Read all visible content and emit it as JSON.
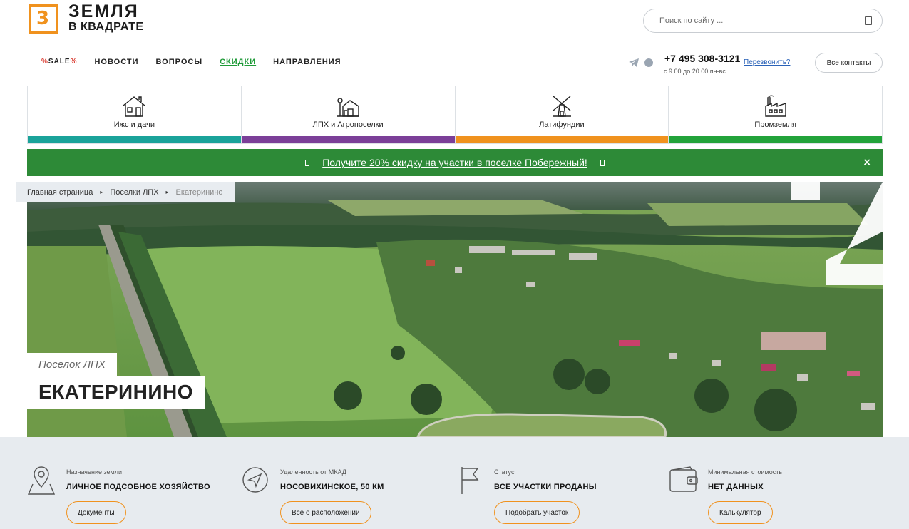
{
  "logo": {
    "line1": "ЗЕМЛЯ",
    "line2": "В КВАДРАТЕ",
    "accent": "#f0921e"
  },
  "search": {
    "placeholder": "Поиск по сайту ..."
  },
  "nav": {
    "sale_prefix": "%",
    "sale_text": "SALE",
    "sale_suffix": "%",
    "items": [
      {
        "label": "НОВОСТИ"
      },
      {
        "label": "ВОПРОСЫ"
      },
      {
        "label": "СКИДКИ"
      },
      {
        "label": "НАПРАВЛЕНИЯ"
      }
    ]
  },
  "contact": {
    "phone": "+7 495 308-3121",
    "hours": "с 9.00 до 20.00 пн-вс",
    "callback": "Перезвонить?",
    "all_contacts": "Все контакты"
  },
  "categories": [
    {
      "label": "Ижс и дачи",
      "color": "#1aa39a",
      "icon": "house-icon"
    },
    {
      "label": "ЛПХ и Агропоселки",
      "color": "#7b3f98",
      "icon": "farm-icon"
    },
    {
      "label": "Латифундии",
      "color": "#f0921e",
      "icon": "windmill-icon"
    },
    {
      "label": "Промземля",
      "color": "#22a33a",
      "icon": "factory-icon"
    }
  ],
  "promo": {
    "text": "Получите 20% скидку на участки в поселке Побережный!",
    "close": "×",
    "color": "#2d8a37"
  },
  "breadcrumb": [
    {
      "label": "Главная страница"
    },
    {
      "label": "Поселки ЛПХ"
    },
    {
      "label": "Екатеринино"
    }
  ],
  "hero": {
    "subtitle": "Поселок ЛПХ",
    "title": "ЕКАТЕРИНИНО"
  },
  "info": [
    {
      "caption": "Назначение земли",
      "value": "ЛИЧНОЕ ПОДСОБНОЕ ХОЗЯЙСТВО",
      "button": "Документы",
      "icon": "location-pin-icon"
    },
    {
      "caption": "Удаленность от МКАД",
      "value": "НОСОВИХИНСКОЕ, 50 КМ",
      "button": "Все о расположении",
      "icon": "navigation-icon"
    },
    {
      "caption": "Статус",
      "value": "ВСЕ УЧАСТКИ ПРОДАНЫ",
      "button": "Подобрать участок",
      "icon": "flag-icon"
    },
    {
      "caption": "Минимальная стоимость",
      "value": "НЕТ ДАННЫХ",
      "button": "Калькулятор",
      "icon": "wallet-icon"
    }
  ]
}
